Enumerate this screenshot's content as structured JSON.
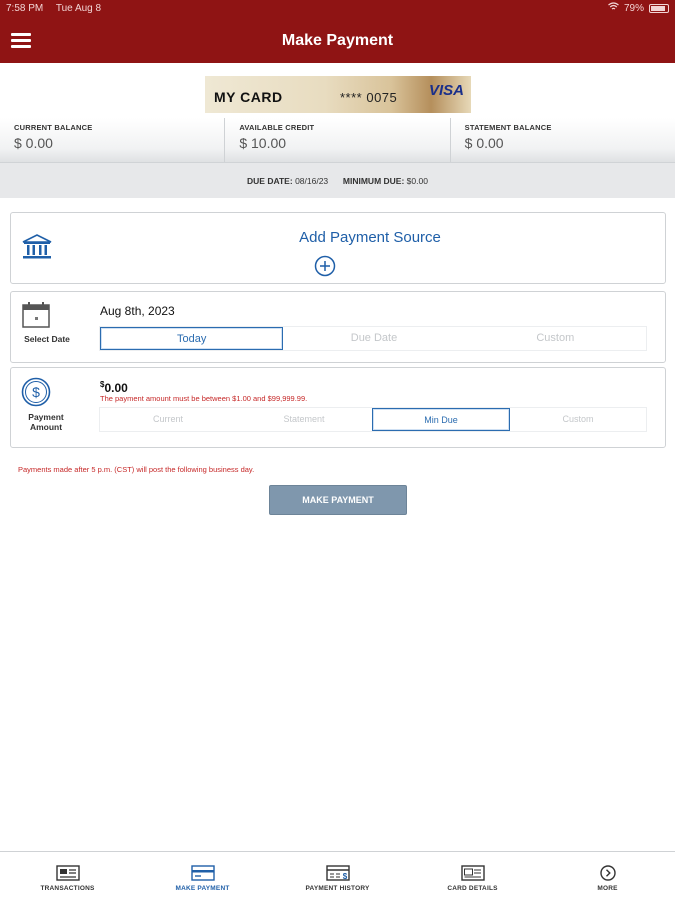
{
  "status_bar": {
    "time": "7:58 PM",
    "date": "Tue Aug 8",
    "battery": "79%"
  },
  "header": {
    "title": "Make Payment",
    "menu_icon": "hamburger-menu-icon"
  },
  "card": {
    "name": "MY CARD",
    "number_masked": "**** 0075",
    "brand": "VISA"
  },
  "balances": [
    {
      "label": "CURRENT BALANCE",
      "value": "$ 0.00"
    },
    {
      "label": "AVAILABLE CREDIT",
      "value": "$ 10.00"
    },
    {
      "label": "STATEMENT BALANCE",
      "value": "$ 0.00"
    }
  ],
  "due": {
    "due_date_label": "DUE DATE:",
    "due_date": "08/16/23",
    "min_due_label": "MINIMUM DUE:",
    "min_due": "$0.00"
  },
  "payment_source": {
    "label": "Add Payment Source",
    "icon": "bank-icon"
  },
  "select_date": {
    "label": "Select Date",
    "value": "Aug 8th, 2023",
    "options": [
      "Today",
      "Due Date",
      "Custom"
    ],
    "selected": "Today"
  },
  "payment_amount": {
    "label_line1": "Payment",
    "label_line2": "Amount",
    "currency": "$",
    "value": "0.00",
    "error": "The payment amount must be between $1.00 and $99,999.99.",
    "options": [
      "Current",
      "Statement",
      "Min Due",
      "Custom"
    ],
    "selected": "Min Due"
  },
  "notice": "Payments made after 5 p.m. (CST) will post the following business day.",
  "submit": {
    "label": "MAKE PAYMENT"
  },
  "bottom_nav": [
    {
      "label": "TRANSACTIONS",
      "icon": "transactions-icon"
    },
    {
      "label": "MAKE PAYMENT",
      "icon": "make-payment-icon",
      "active": true
    },
    {
      "label": "PAYMENT HISTORY",
      "icon": "payment-history-icon"
    },
    {
      "label": "CARD DETAILS",
      "icon": "card-details-icon"
    },
    {
      "label": "MORE",
      "icon": "more-icon"
    }
  ],
  "colors": {
    "header": "#8f1414",
    "accent": "#1f5fa8",
    "error": "#c62828",
    "button": "#7f97ad"
  }
}
